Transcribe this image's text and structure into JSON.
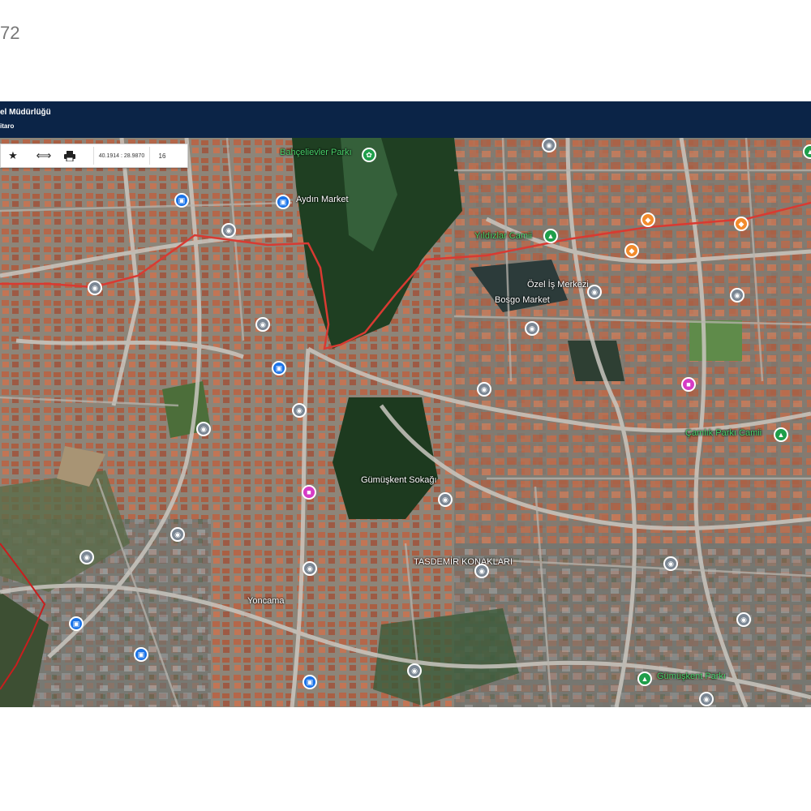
{
  "page_number": "72",
  "header": {
    "title": "el Müdürlüğü",
    "subtitle": "itaro"
  },
  "toolbar": {
    "favorite_icon": "star-icon",
    "measure_icon": "ruler-icon",
    "print_icon": "printer-icon",
    "coordinates": "40.1914 : 28.9870",
    "zoom_level": "16"
  },
  "map": {
    "colors": {
      "header": "#0b2447",
      "route": "#d93a32",
      "boundary": "#c81e1e",
      "poi_blue": "#1a73e8",
      "poi_gray": "#7b8794",
      "poi_orange": "#f28b2c",
      "poi_pink": "#d63bc6",
      "poi_green": "#1e9e4a"
    },
    "labels": [
      {
        "text": "Bahçelievler Parkı",
        "color": "green"
      },
      {
        "text": "Aydın Market",
        "color": "white"
      },
      {
        "text": "Gümüşkent Sokağı",
        "color": "white"
      },
      {
        "text": "Yoncama",
        "color": "white"
      },
      {
        "text": "Özel İş Merkezi",
        "color": "white"
      },
      {
        "text": "Bosgo Market",
        "color": "white"
      },
      {
        "text": "TASDEMİR KONAKLARI",
        "color": "white"
      },
      {
        "text": "Çamlık Parkı Camii",
        "color": "green"
      },
      {
        "text": "Yıldızlar Camii",
        "color": "green"
      },
      {
        "text": "Gümüşkent Parkı",
        "color": "green"
      }
    ]
  }
}
